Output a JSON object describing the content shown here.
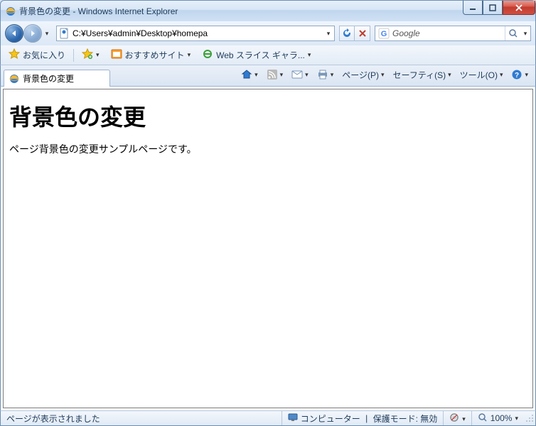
{
  "window": {
    "title": "背景色の変更 - Windows Internet Explorer"
  },
  "address": {
    "path_text": "C:¥Users¥admin¥Desktop¥homepa"
  },
  "search": {
    "provider": "Google"
  },
  "favbar": {
    "favorites_label": "お気に入り",
    "suggested_sites_label": "おすすめサイト",
    "web_slice_label": "Web スライス ギャラ..."
  },
  "tab": {
    "title": "背景色の変更"
  },
  "commandbar": {
    "page_label": "ページ(P)",
    "safety_label": "セーフティ(S)",
    "tools_label": "ツール(O)"
  },
  "page_content": {
    "heading": "背景色の変更",
    "paragraph": "ページ背景色の変更サンプルページです。"
  },
  "statusbar": {
    "ready_text": "ページが表示されました",
    "zone_text": "コンピューター",
    "protected_mode_text": "保護モード: 無効",
    "zoom_text": "100%"
  }
}
